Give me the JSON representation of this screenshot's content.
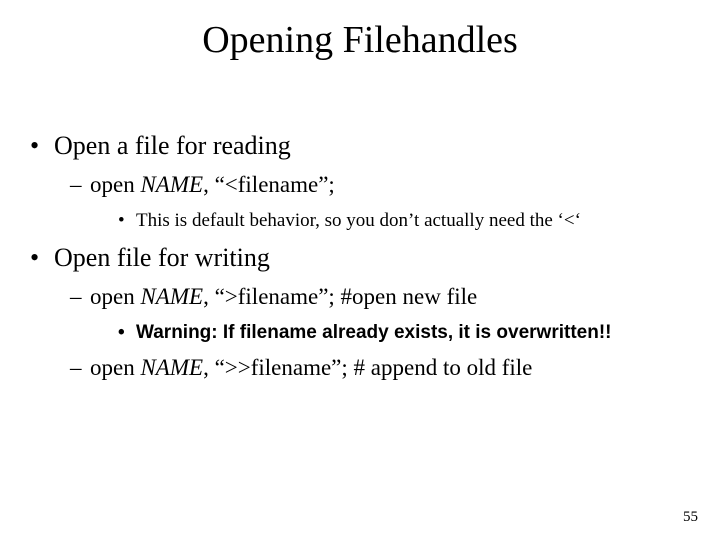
{
  "title": "Opening Filehandles",
  "bullet1": "Open a file for reading",
  "sub1_open": "open ",
  "sub1_name": "NAME",
  "sub1_rest": ", “<filename”;",
  "sub1_note": "This is default behavior, so you don’t actually need the ‘<‘",
  "bullet2": "Open file for writing",
  "sub2a_open": "open ",
  "sub2a_name": "NAME",
  "sub2a_rest": ", “>filename”; #open new file",
  "sub2a_note": "Warning: If filename already exists, it is overwritten!!",
  "sub2b_open": "open ",
  "sub2b_name": "NAME",
  "sub2b_rest": ", “>>filename”; # append to old file",
  "page_number": "55"
}
